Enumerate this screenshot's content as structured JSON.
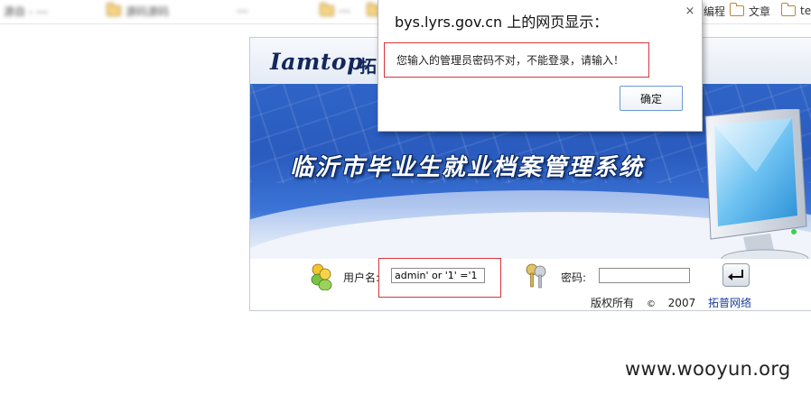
{
  "bookmarks": {
    "blurred": [
      "源自 -   ---",
      "   源码源码",
      "  ---  ",
      "   ---",
      "    "
    ],
    "visible": [
      "编程",
      "文章",
      "te"
    ]
  },
  "dialog": {
    "title": "bys.lyrs.gov.cn 上的网页显示：",
    "close_glyph": "×",
    "message": "您输入的管理员密码不对，不能登录，请输入！",
    "ok_label": "确定"
  },
  "login": {
    "logo_text": "Iamtop",
    "logo_cn": "拓",
    "system_title": "临沂市毕业生就业档案管理系统",
    "username_label": "用户名:",
    "username_value": "admin' or '1' ='1",
    "password_label": "密码:",
    "password_value": "",
    "copyright": "版权所有",
    "copyright_symbol": "©",
    "year": "2007",
    "company_link": "拓普网络"
  },
  "watermark": "www.wooyun.org",
  "colors": {
    "highlight_red": "#d6343b",
    "banner_blue": "#2f64c6",
    "link_blue": "#1a3d9e"
  }
}
